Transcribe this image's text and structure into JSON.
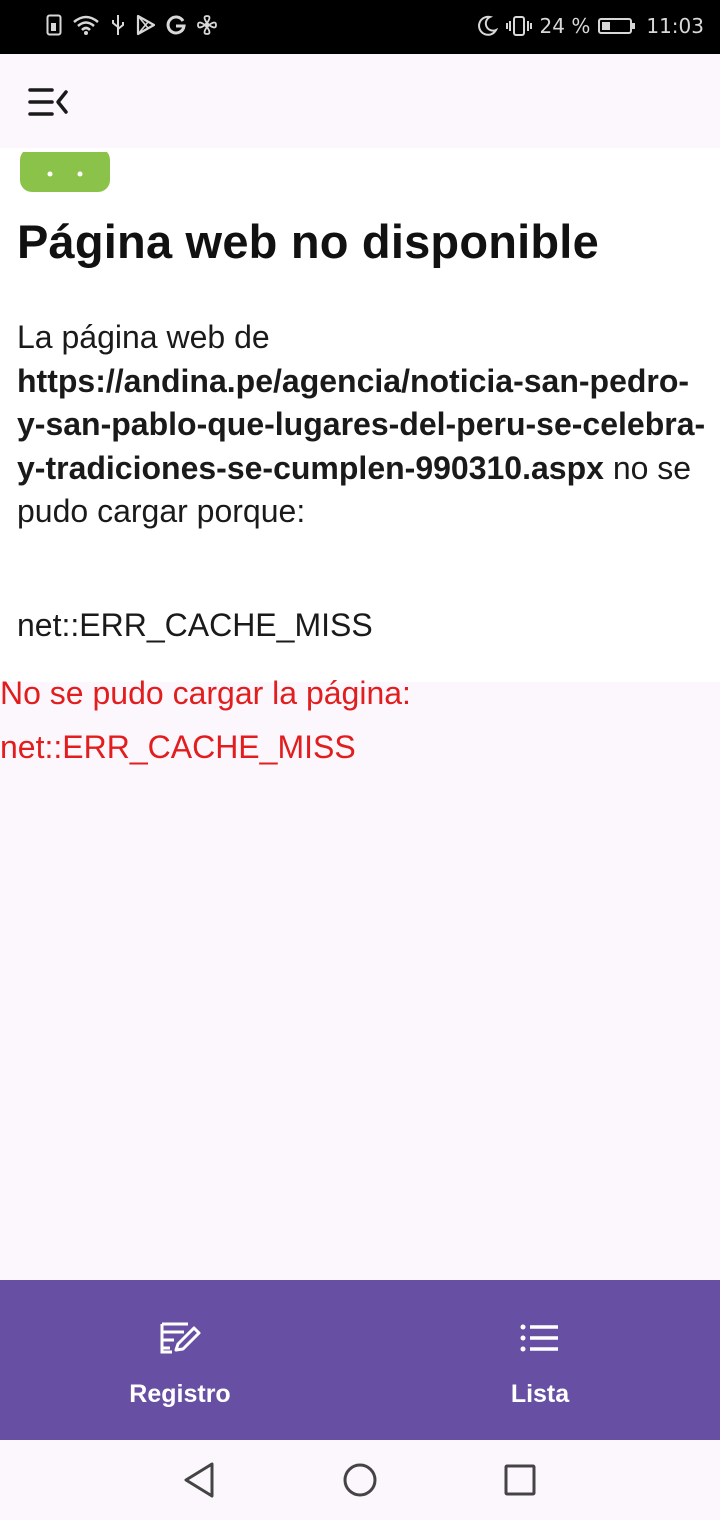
{
  "status_bar": {
    "battery": "24 %",
    "time": "11:03",
    "battery_level": 0.24,
    "left_icons": [
      "sim-icon",
      "wifi-icon",
      "usb-icon",
      "play-store-icon",
      "google-icon",
      "fan-icon"
    ],
    "right_icons": [
      "moon-icon",
      "vibrate-icon",
      "battery-icon"
    ]
  },
  "app_bar": {
    "menu_icon": "menu-collapse-icon"
  },
  "webview": {
    "title": "Página web no disponible",
    "intro": "La página web de",
    "url": "https://andina.pe/agencia/noticia-san-pedro-y-san-pablo-que-lugares-del-peru-se-celebra-y-tradiciones-se-cumplen-990310.aspx",
    "reason": "no se pudo cargar porque:",
    "error_code": "net::ERR_CACHE_MISS",
    "android_color": "#8bc34a"
  },
  "app_error": {
    "line1": "No se pudo cargar la página:",
    "line2": "net::ERR_CACHE_MISS",
    "color": "#e21d1d"
  },
  "bottom_nav": {
    "background": "#6750a4",
    "items": [
      {
        "label": "Registro",
        "icon": "edit-note-icon"
      },
      {
        "label": "Lista",
        "icon": "list-icon"
      }
    ]
  },
  "system_nav": {
    "buttons": [
      "back-icon",
      "home-icon",
      "recents-icon"
    ]
  }
}
